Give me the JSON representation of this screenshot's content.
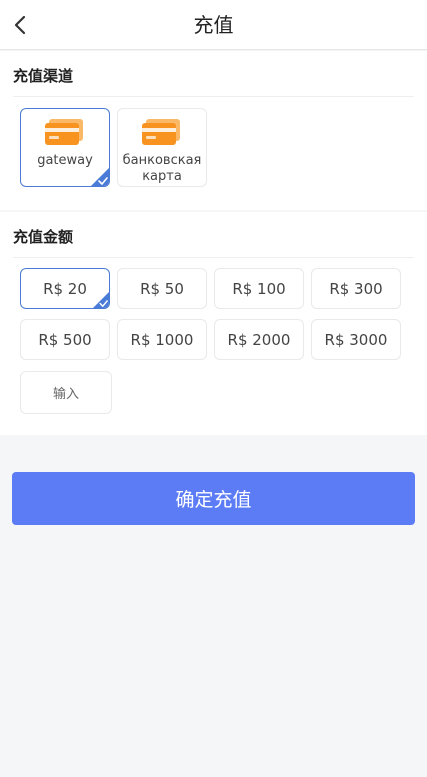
{
  "header": {
    "title": "充值"
  },
  "channel_section": {
    "title": "充值渠道",
    "channels": [
      {
        "label": "gateway",
        "selected": true
      },
      {
        "label": "банковская карта",
        "selected": false
      }
    ]
  },
  "amount_section": {
    "title": "充值金额",
    "amounts": [
      "R$ 20",
      "R$ 50",
      "R$ 100",
      "R$ 300",
      "R$ 500",
      "R$ 1000",
      "R$ 2000",
      "R$ 3000"
    ],
    "selected_amount": "R$ 20",
    "custom_input_label": "输入"
  },
  "confirm_button": {
    "label": "确定充值"
  },
  "colors": {
    "accent": "#5c7cf6",
    "selected_border": "#4a7bd6",
    "card_icon": "#f7931e",
    "background": "#f5f6f8"
  }
}
